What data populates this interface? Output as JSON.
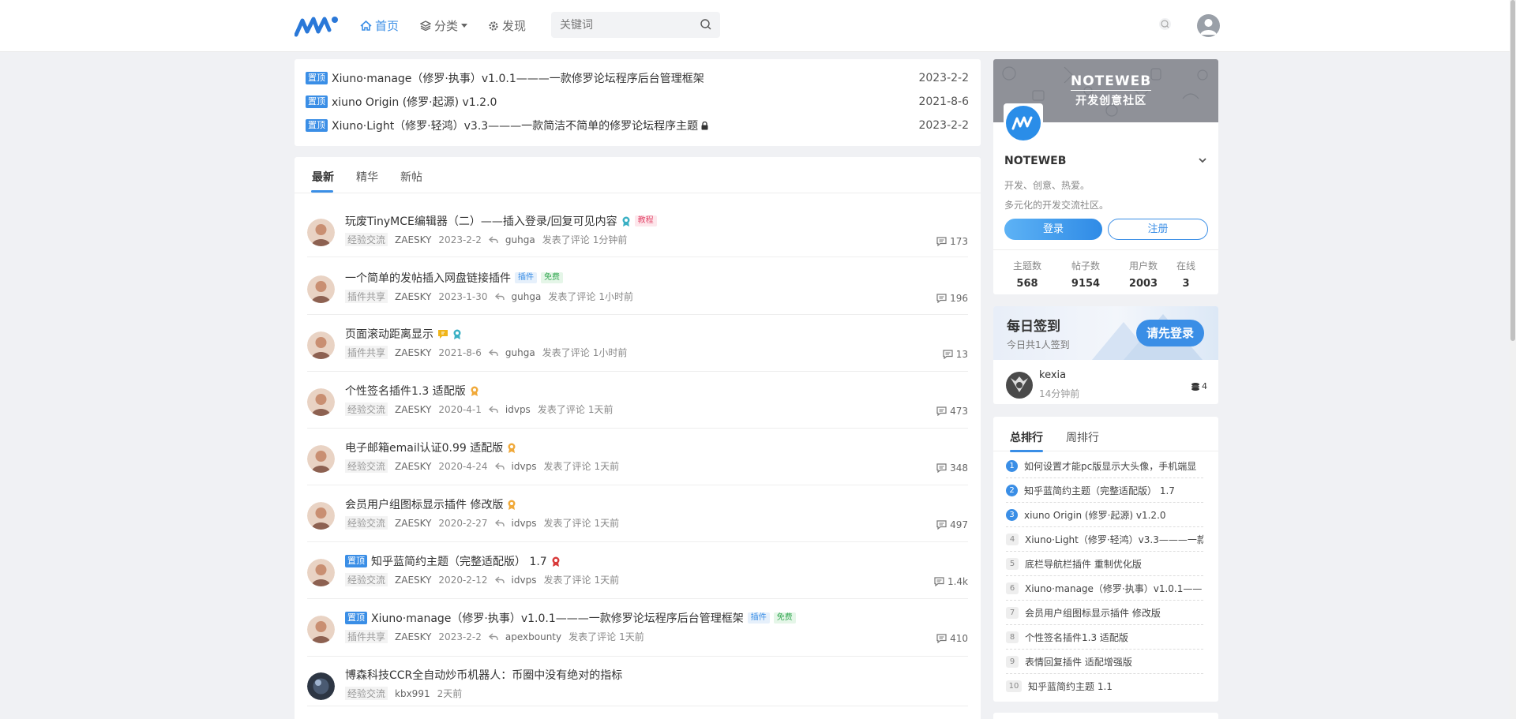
{
  "nav": {
    "home": "首页",
    "category": "分类",
    "discover": "发现",
    "search_placeholder": "关键词"
  },
  "sticky": [
    {
      "badge": "置顶",
      "title": "Xiuno·manage（修罗·执事）v1.0.1———一款修罗论坛程序后台管理框架",
      "date": "2023-2-2"
    },
    {
      "badge": "置顶",
      "title": "xiuno Origin (修罗·起源) v1.2.0",
      "date": "2021-8-6"
    },
    {
      "badge": "置顶",
      "title": "Xiuno·Light（修罗·轻鸿）v3.3———一款简洁不简单的修罗论坛程序主题",
      "date": "2023-2-2"
    }
  ],
  "tabs": [
    "最新",
    "精华",
    "新帖"
  ],
  "threads": [
    {
      "title": "玩废TinyMCE编辑器（二）——插入登录/回复可见内容",
      "tags": [
        "教程"
      ],
      "category": "经验交流",
      "author": "ZAESKY",
      "date": "2023-2-2",
      "replier": "guhga",
      "action": "发表了评论",
      "time": "1分钟前",
      "count": "173"
    },
    {
      "title": "一个简单的发帖插入网盘链接插件",
      "tags": [
        "插件",
        "免费"
      ],
      "category": "插件共享",
      "author": "ZAESKY",
      "date": "2023-1-30",
      "replier": "guhga",
      "action": "发表了评论",
      "time": "1小时前",
      "count": "196"
    },
    {
      "title": "页面滚动距离显示",
      "category": "插件共享",
      "author": "ZAESKY",
      "date": "2021-8-6",
      "replier": "guhga",
      "action": "发表了评论",
      "time": "1小时前",
      "count": "13"
    },
    {
      "title": "个性签名插件1.3 适配版",
      "category": "经验交流",
      "author": "ZAESKY",
      "date": "2020-4-1",
      "replier": "idvps",
      "action": "发表了评论",
      "time": "1天前",
      "count": "473"
    },
    {
      "title": "电子邮箱email认证0.99 适配版",
      "category": "经验交流",
      "author": "ZAESKY",
      "date": "2020-4-24",
      "replier": "idvps",
      "action": "发表了评论",
      "time": "1天前",
      "count": "348"
    },
    {
      "title": "会员用户组图标显示插件 修改版",
      "category": "经验交流",
      "author": "ZAESKY",
      "date": "2020-2-27",
      "replier": "idvps",
      "action": "发表了评论",
      "time": "1天前",
      "count": "497"
    },
    {
      "badge": "置顶",
      "title": "知乎蓝简约主题（完整适配版） 1.7",
      "category": "经验交流",
      "author": "ZAESKY",
      "date": "2020-2-12",
      "replier": "idvps",
      "action": "发表了评论",
      "time": "1天前",
      "count": "1.4k"
    },
    {
      "badge": "置顶",
      "title": "Xiuno·manage（修罗·执事）v1.0.1———一款修罗论坛程序后台管理框架",
      "tags": [
        "插件",
        "免费"
      ],
      "category": "插件共享",
      "author": "ZAESKY",
      "date": "2023-2-2",
      "replier": "apexbounty",
      "action": "发表了评论",
      "time": "1天前",
      "count": "410"
    },
    {
      "title": "博森科技CCR全自动炒币机器人：币圈中没有绝对的指标",
      "category": "经验交流",
      "author": "kbx991",
      "time": "2天前"
    }
  ],
  "side": {
    "brand1": "NOTEWEB",
    "brand2": "开发创意社区",
    "name": "NOTEWEB",
    "desc1": "开发、创意、热爱。",
    "desc2": "多元化的开发交流社区。",
    "login": "登录",
    "register": "注册",
    "stats": [
      {
        "label": "主题数",
        "value": "568"
      },
      {
        "label": "帖子数",
        "value": "9154"
      },
      {
        "label": "用户数",
        "value": "2003"
      },
      {
        "label": "在线",
        "value": "3"
      }
    ]
  },
  "checkin": {
    "title": "每日签到",
    "sub": "今日共1人签到",
    "button": "请先登录",
    "user": "kexia",
    "time": "14分钟前",
    "coins": "4"
  },
  "rank": {
    "tabs": [
      "总排行",
      "周排行"
    ],
    "items": [
      {
        "n": "1",
        "title": "如何设置才能pc版显示大头像，手机端显"
      },
      {
        "n": "2",
        "title": "知乎蓝简约主题（完整适配版） 1.7"
      },
      {
        "n": "3",
        "title": "xiuno Origin (修罗·起源) v1.2.0"
      },
      {
        "n": "4",
        "title": "Xiuno·Light（修罗·轻鸿）v3.3———一款"
      },
      {
        "n": "5",
        "title": "底栏导航栏插件 重制优化版"
      },
      {
        "n": "6",
        "title": "Xiuno·manage（修罗·执事）v1.0.1——"
      },
      {
        "n": "7",
        "title": "会员用户组图标显示插件 修改版"
      },
      {
        "n": "8",
        "title": "个性签名插件1.3 适配版"
      },
      {
        "n": "9",
        "title": "表情回复插件 适配增强版"
      },
      {
        "n": "10",
        "title": "知乎蓝简约主题 1.1"
      }
    ]
  },
  "colors": {
    "accent": "#3a8ee6",
    "background": "#f0f1f4"
  }
}
